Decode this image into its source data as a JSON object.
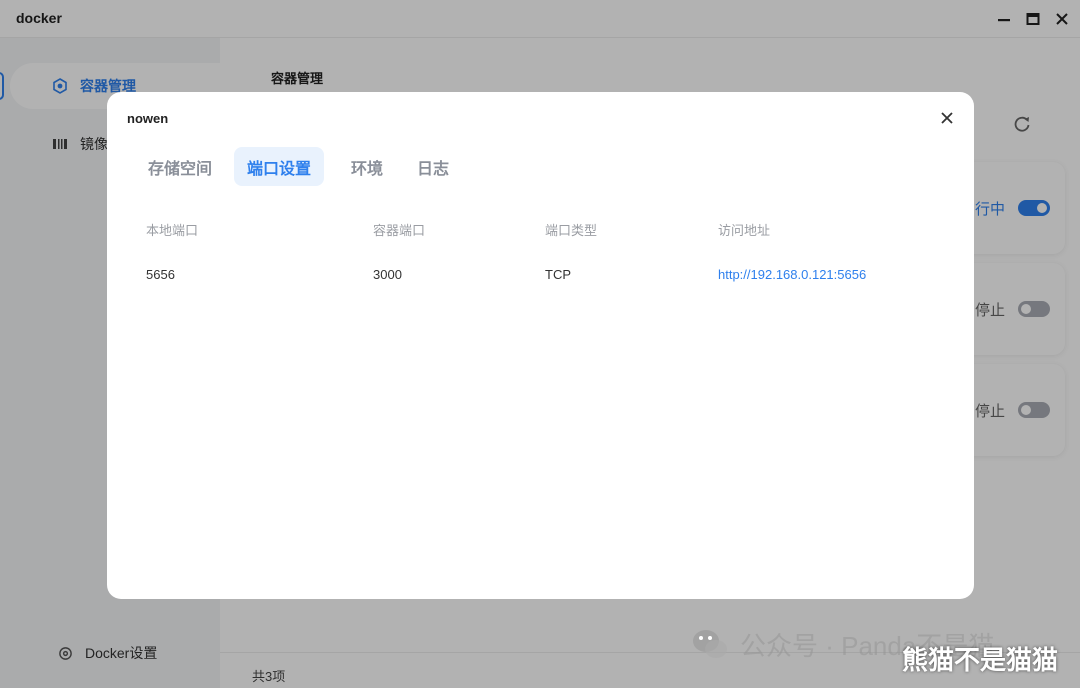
{
  "app": {
    "title": "docker"
  },
  "sidebar": {
    "items": [
      {
        "label": "容器管理",
        "icon": "container-icon",
        "active": true
      },
      {
        "label": "镜像",
        "icon": "image-icon",
        "active": false
      }
    ],
    "settings_label": "Docker设置"
  },
  "main": {
    "title": "容器管理",
    "cards": [
      {
        "status": "行中",
        "running": true
      },
      {
        "status": "停止",
        "running": false
      },
      {
        "status": "停止",
        "running": false
      }
    ],
    "total_label": "共3项"
  },
  "modal": {
    "title": "nowen",
    "tabs": [
      {
        "label": "存储空间",
        "active": false
      },
      {
        "label": "端口设置",
        "active": true
      },
      {
        "label": "环境",
        "active": false
      },
      {
        "label": "日志",
        "active": false
      }
    ],
    "columns": [
      "本地端口",
      "容器端口",
      "端口类型",
      "访问地址"
    ],
    "rows": [
      {
        "local": "5656",
        "container": "3000",
        "type": "TCP",
        "address": "http://192.168.0.121:5656"
      }
    ]
  },
  "watermark": {
    "text": "公众号 · Panda不是猫",
    "overlay": "熊猫不是猫猫"
  },
  "colors": {
    "accent": "#2f80ed",
    "tab_bg": "#e9f2fd",
    "toggle_off": "#a9adb5"
  }
}
